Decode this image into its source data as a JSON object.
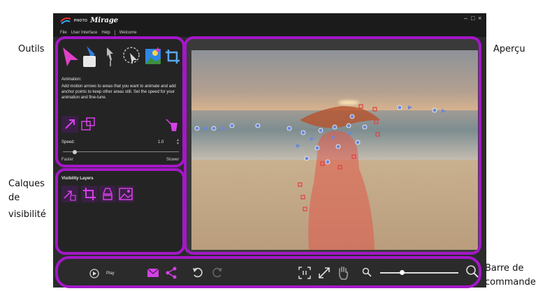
{
  "annotations": {
    "outils": "Outils",
    "apercu": "Aperçu",
    "calques_line1": "Calques",
    "calques_line2": "de",
    "calques_line3": "visibilité",
    "barre_line1": "Barre de",
    "barre_line2": "commande"
  },
  "app": {
    "logo_small": "PHOTO",
    "logo_big": "Mirage",
    "minimize": "–",
    "maximize": "□",
    "close": "×"
  },
  "menu": {
    "file": "File",
    "user_interface": "User Interface",
    "help": "Help",
    "welcome": "Welcome"
  },
  "tools": {
    "icons": [
      "animation-arrow-icon",
      "eraser-icon",
      "anchor-pin-icon",
      "lasso-select-icon",
      "sky-image-icon",
      "crop-icon"
    ],
    "animation_title": "Animation:",
    "animation_desc": "Add motion arrows to areas that you want to animate and add anchor points to keep other areas still. Set the speed for your animation and fine-tune.",
    "speed_label": "Speed:",
    "speed_value": "1.0",
    "speed_fraction": 0.1,
    "faster": "Faster",
    "slower": "Slower"
  },
  "visibility": {
    "title": "Visibility Layers"
  },
  "command": {
    "play": "Play",
    "zoom_fraction": 0.28
  },
  "colors": {
    "highlight": "#a417c8",
    "accent_icon": "#cc33ee",
    "mask": "#e0584a"
  }
}
